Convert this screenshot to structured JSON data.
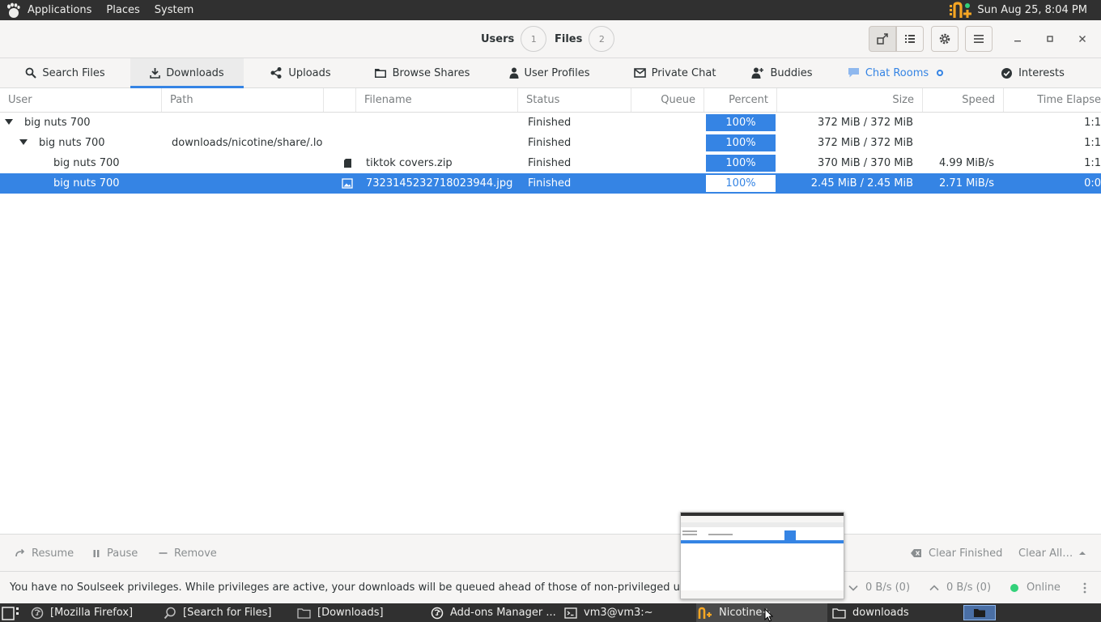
{
  "top_panel": {
    "menus": [
      "Applications",
      "Places",
      "System"
    ],
    "clock": "Sun Aug 25,  8:04 PM"
  },
  "header": {
    "users_label": "Users",
    "users_count": "1",
    "files_label": "Files",
    "files_count": "2"
  },
  "tabs": [
    {
      "label": "Search Files",
      "icon": "search-icon"
    },
    {
      "label": "Downloads",
      "icon": "download-icon",
      "active": true
    },
    {
      "label": "Uploads",
      "icon": "share-icon"
    },
    {
      "label": "Browse Shares",
      "icon": "folder-icon"
    },
    {
      "label": "User Profiles",
      "icon": "person-icon"
    },
    {
      "label": "Private Chat",
      "icon": "envelope-icon"
    },
    {
      "label": "Buddies",
      "icon": "add-person-icon"
    },
    {
      "label": "Chat Rooms",
      "icon": "chat-bubble-icon",
      "highlight": true
    },
    {
      "label": "Interests",
      "icon": "check-circle-icon"
    }
  ],
  "columns": [
    "User",
    "Path",
    "Filename",
    "Status",
    "Queue",
    "Percent",
    "Size",
    "Speed",
    "Time Elapse"
  ],
  "rows": [
    {
      "user": "big nuts 700",
      "path": "",
      "filename": "",
      "status": "Finished",
      "queue": "",
      "percent": "100%",
      "size": "372 MiB / 372 MiB",
      "speed": "",
      "elapsed": "1:1"
    },
    {
      "user": "big nuts 700",
      "path": "downloads/nicotine/share/.loca",
      "filename": "",
      "status": "Finished",
      "queue": "",
      "percent": "100%",
      "size": "372 MiB / 372 MiB",
      "speed": "",
      "elapsed": "1:1"
    },
    {
      "user": "big nuts 700",
      "path": "",
      "filename": "tiktok covers.zip",
      "status": "Finished",
      "queue": "",
      "percent": "100%",
      "size": "370 MiB / 370 MiB",
      "speed": "4.99 MiB/s",
      "elapsed": "1:1"
    },
    {
      "user": "big nuts 700",
      "path": "",
      "filename": "7323145232718023944.jpg",
      "status": "Finished",
      "queue": "",
      "percent": "100%",
      "size": "2.45 MiB / 2.45 MiB",
      "speed": "2.71 MiB/s",
      "elapsed": "0:0"
    }
  ],
  "actions": {
    "resume": "Resume",
    "pause": "Pause",
    "remove": "Remove",
    "clear_finished": "Clear Finished",
    "clear_all": "Clear All…"
  },
  "status_bar": {
    "message": "You have no Soulseek privileges. While privileges are active, your downloads will be queued ahead of those of non-privileged users.",
    "download_speed": "0 B/s (0)",
    "upload_speed": "0 B/s (0)",
    "connection": "Online"
  },
  "taskbar": [
    "[Mozilla Firefox]",
    "[Search for Files]",
    "[Downloads]",
    "Add-ons Manager ...",
    "vm3@vm3:~",
    "Nicotine+",
    "downloads"
  ],
  "colors": {
    "accent": "#3584e4",
    "panel": "#303030",
    "online": "#33d17a"
  }
}
